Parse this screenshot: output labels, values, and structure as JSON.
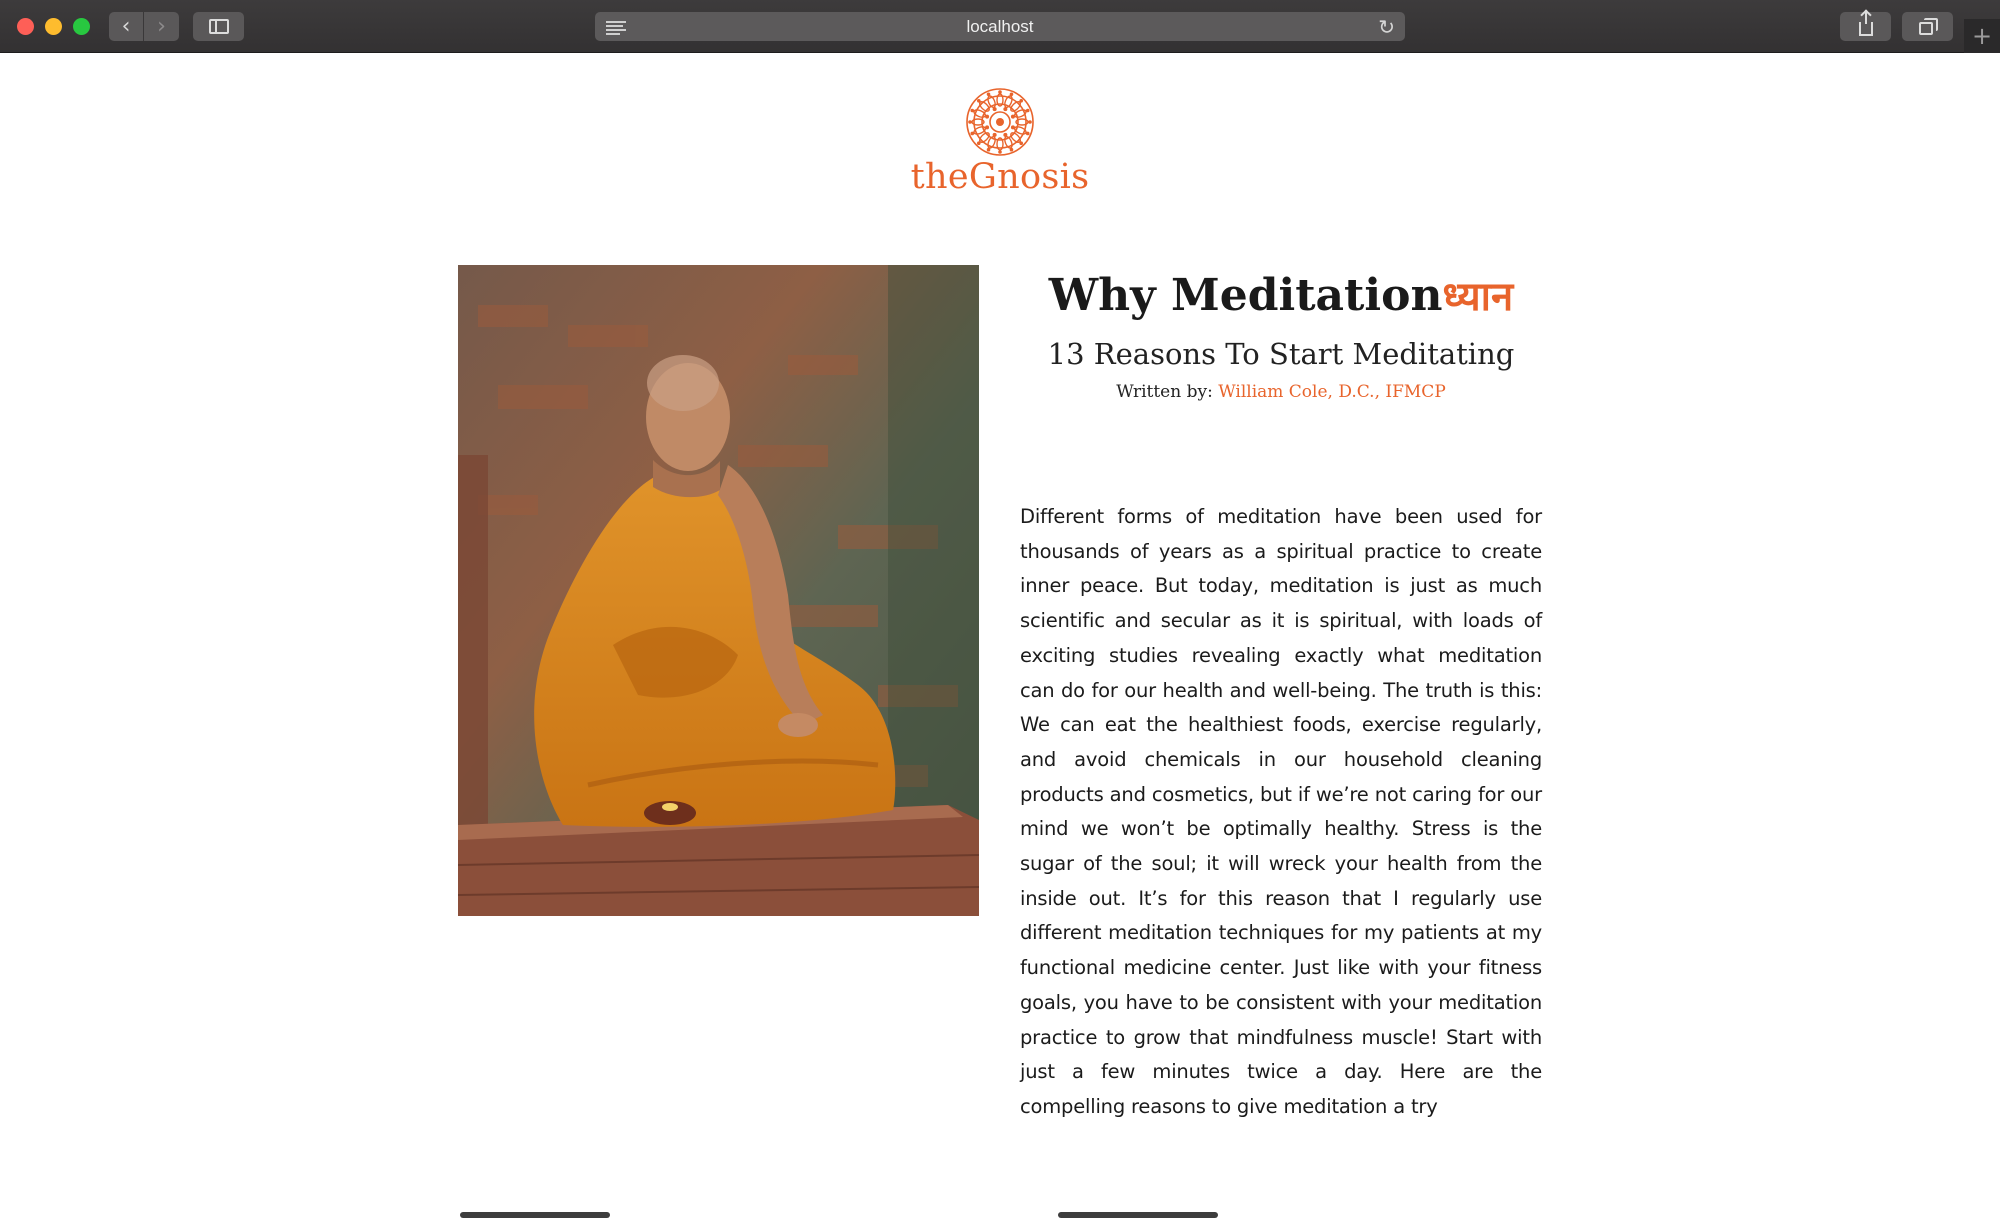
{
  "browser": {
    "url": "localhost",
    "icons": {
      "back": "chevron-left-icon",
      "forward": "chevron-right-icon",
      "sidebar": "sidebar-icon",
      "reader": "reader-icon",
      "reload": "reload-icon",
      "share": "share-icon",
      "tabs": "tabs-icon",
      "new_tab": "plus-icon"
    }
  },
  "header": {
    "brand": "theGnosis",
    "logo_icon": "mandala-logo-icon"
  },
  "article": {
    "title": "Why Meditation",
    "title_accent": "ध्यान",
    "subtitle": "13 Reasons To Start Meditating",
    "byline_label": "Written by:",
    "author": "William Cole, D.C., IFMCP",
    "image_subject": "meditating-monk-photo",
    "body": "Different forms of meditation have been used for thousands of years as a spiritual practice to create inner peace. But today, meditation is just as much scientific and secular as it is spiritual, with loads of exciting studies revealing exactly what meditation can do for our health and well-being. The truth is this: We can eat the healthiest foods, exercise regularly, and avoid chemicals in our household cleaning products and cosmetics, but if we’re not caring for our mind we won’t be optimally healthy. Stress is the sugar of the soul; it will wreck your health from the inside out. It’s for this reason that I regularly use different meditation techniques for my patients at my functional medicine center. Just like with your fitness goals, you have to be consistent with your meditation practice to grow that mindfulness muscle! Start with just a few minutes twice a day. Here are the compelling reasons to give meditation a try"
  },
  "colors": {
    "accent": "#e8642c",
    "chrome": "#383637",
    "text": "#1b1b1b"
  }
}
